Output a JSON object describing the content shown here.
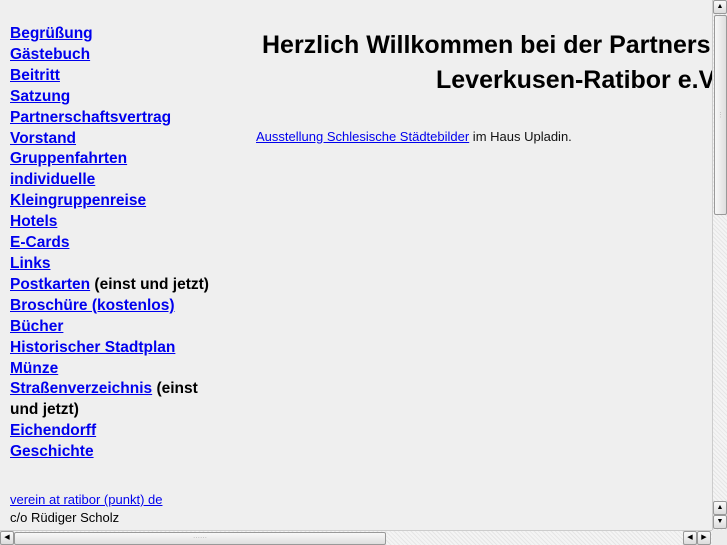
{
  "sidebar": {
    "items": [
      {
        "label": "Begrüßung"
      },
      {
        "label": "Gästebuch "
      },
      {
        "label": "Beitritt"
      },
      {
        "label": "Satzung"
      },
      {
        "label": "Partnerschaftsvertrag"
      },
      {
        "label": "Vorstand"
      },
      {
        "label": "Gruppenfahrten"
      },
      {
        "label": "individuelle Kleingruppenreise"
      },
      {
        "label": "Hotels"
      },
      {
        "label": "E-Cards"
      },
      {
        "label": "Links"
      },
      {
        "label": "Postkarten",
        "suffix": " (einst und jetzt)"
      },
      {
        "label": "Broschüre (kostenlos)"
      },
      {
        "label": "Bücher"
      },
      {
        "label": "Historischer Stadtplan"
      },
      {
        "label": "Münze"
      },
      {
        "label": "Straßenverzeichnis",
        "suffix": " (einst und jetzt)"
      },
      {
        "label": "Eichendorff"
      },
      {
        "label": "Geschichte"
      }
    ]
  },
  "contact": {
    "email_link": "verein at ratibor (punkt) de",
    "address_line": "c/o Rüdiger Scholz"
  },
  "header": {
    "line1": "Herzlich Willkommen bei der Partners",
    "line2": "Leverkusen-Ratibor e.V"
  },
  "news": {
    "link": "Ausstellung Schlesische Städtebilder",
    "text": " im Haus Upladin."
  }
}
